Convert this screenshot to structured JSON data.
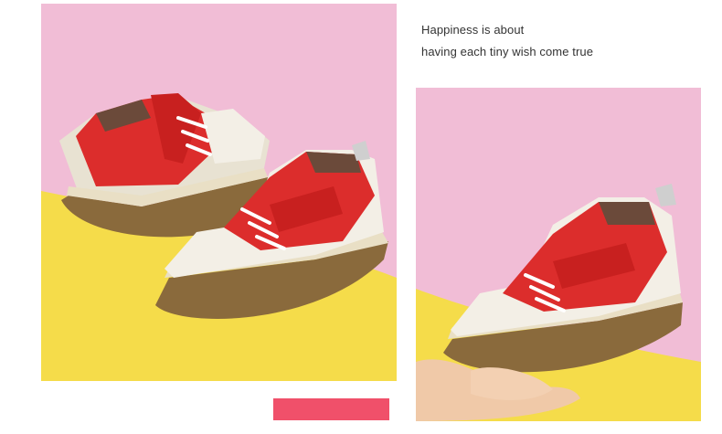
{
  "tagline": {
    "line1": "Happiness is about",
    "line2": "having each tiny wish come true"
  },
  "colors": {
    "pink_background": "#f1bdd6",
    "yellow_background": "#f5dc4a",
    "shoe_red": "#dc2d2c",
    "shoe_white": "#f3efe6",
    "sole_brown": "#8a6a3c",
    "accent_bar": "#f0506a",
    "text": "#333333"
  },
  "images": {
    "left": "product-photo-pair-of-red-white-kids-sneakers",
    "right": "product-photo-single-red-white-sneaker-held-in-hand"
  }
}
